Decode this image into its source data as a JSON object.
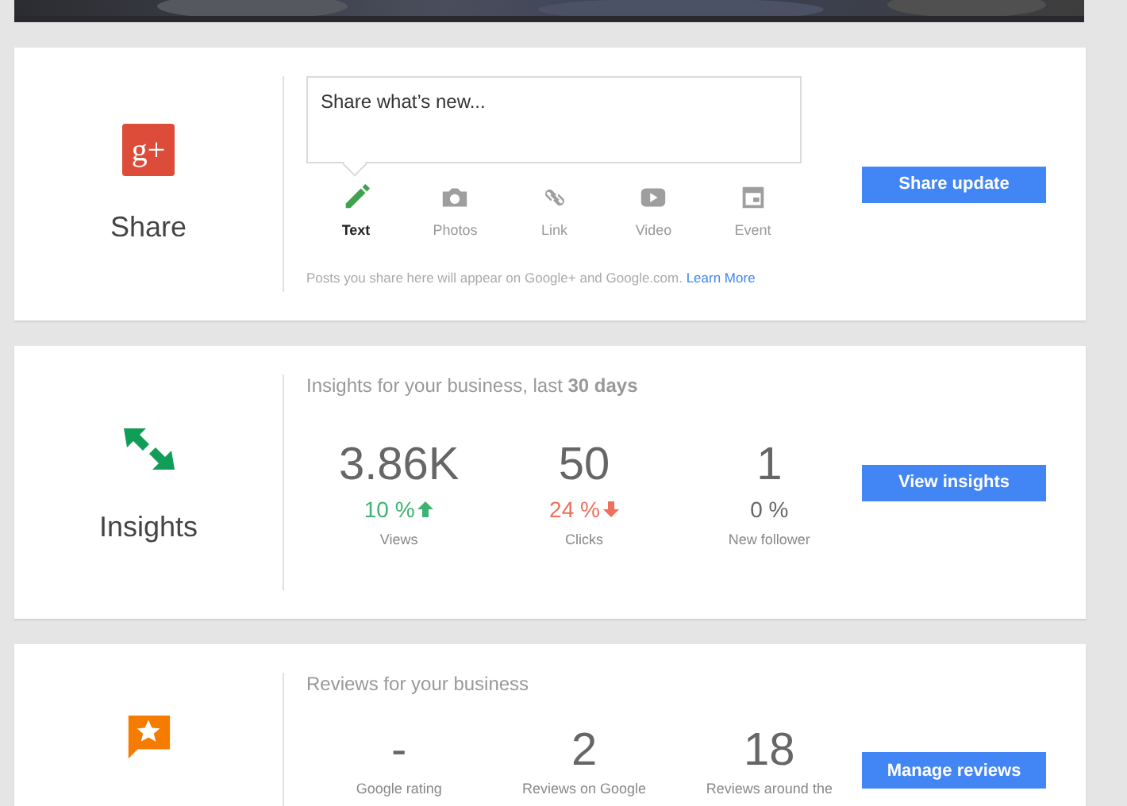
{
  "share": {
    "logo": "g+",
    "title": "Share",
    "placeholder": "Share what’s new...",
    "tools": [
      {
        "kind": "pencil",
        "label": "Text",
        "selected": true
      },
      {
        "kind": "camera",
        "label": "Photos",
        "selected": false
      },
      {
        "kind": "link",
        "label": "Link",
        "selected": false
      },
      {
        "kind": "video",
        "label": "Video",
        "selected": false
      },
      {
        "kind": "event",
        "label": "Event",
        "selected": false
      }
    ],
    "note": "Posts you share here will appear on Google+ and Google.com.",
    "note_link": "Learn More",
    "button": "Share update"
  },
  "insights": {
    "title": "Insights",
    "heading": "Insights for your business, last **30 days**",
    "stats": [
      {
        "value": "3.86K",
        "change": "10 %",
        "kind": "up",
        "label": "Views"
      },
      {
        "value": "50",
        "change": "24 %",
        "kind": "down",
        "label": "Clicks"
      },
      {
        "value": "1",
        "change": "0 %",
        "kind": "none",
        "label": "New follower"
      }
    ],
    "button": "View insights"
  },
  "reviews": {
    "heading": "Reviews for your business",
    "stats": [
      {
        "value": "-",
        "label": "Google rating"
      },
      {
        "value": "2",
        "label": "Reviews on Google"
      },
      {
        "value": "18",
        "label": "Reviews around the"
      }
    ],
    "button": "Manage reviews"
  }
}
